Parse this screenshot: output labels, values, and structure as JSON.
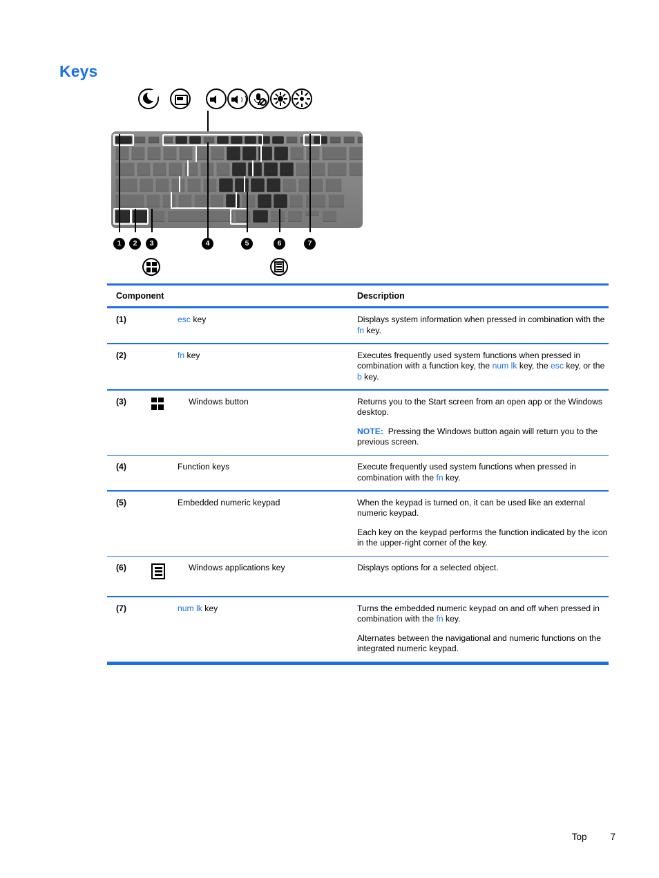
{
  "heading": "Keys",
  "figure": {
    "function_key_icons": [
      {
        "name": "sleep-icon",
        "label": "sleep"
      },
      {
        "name": "display-switch-icon",
        "label": "display switch"
      },
      {
        "name": "volume-down-icon",
        "label": "volume down"
      },
      {
        "name": "volume-up-icon",
        "label": "volume up"
      },
      {
        "name": "microphone-mute-icon",
        "label": "microphone mute"
      },
      {
        "name": "brightness-down-icon",
        "label": "brightness down"
      },
      {
        "name": "brightness-up-icon",
        "label": "brightness up"
      }
    ],
    "callouts": [
      "1",
      "2",
      "3",
      "4",
      "5",
      "6",
      "7"
    ],
    "callout_icons": [
      {
        "name": "windows-key-icon",
        "for_callout": "3"
      },
      {
        "name": "windows-applications-key-icon",
        "for_callout": "6"
      }
    ],
    "keyboard_keys": [
      "esc",
      "fn",
      "Windows",
      "Function keys",
      "Embedded numeric keypad",
      "Windows applications key",
      "num lk"
    ]
  },
  "table": {
    "headers": {
      "component": "Component",
      "description": "Description"
    },
    "rows": [
      {
        "number": "(1)",
        "icon": "",
        "component_pre": "",
        "component_kw": "esc",
        "component_post": " key",
        "description": [
          {
            "segments": [
              {
                "t": "Displays system information when pressed in combination with the ",
                "kw": false
              },
              {
                "t": "fn",
                "kw": true
              },
              {
                "t": " key.",
                "kw": false
              }
            ]
          }
        ]
      },
      {
        "number": "(2)",
        "icon": "",
        "component_pre": "",
        "component_kw": "fn",
        "component_post": " key",
        "description": [
          {
            "segments": [
              {
                "t": "Executes frequently used system functions when pressed in combination with a function key, the ",
                "kw": false
              },
              {
                "t": "num lk",
                "kw": true
              },
              {
                "t": " key, the ",
                "kw": false
              },
              {
                "t": "esc",
                "kw": true
              },
              {
                "t": " key, or the ",
                "kw": false
              },
              {
                "t": "b",
                "kw": true
              },
              {
                "t": " key.",
                "kw": false
              }
            ]
          }
        ]
      },
      {
        "number": "(3)",
        "icon": "windows-logo",
        "component_pre": "Windows button",
        "component_kw": "",
        "component_post": "",
        "description": [
          {
            "segments": [
              {
                "t": "Returns you to the Start screen from an open app or the Windows desktop.",
                "kw": false
              }
            ]
          },
          {
            "note": "NOTE:",
            "segments": [
              {
                "t": "Pressing the Windows button again will return you to the previous screen.",
                "kw": false
              }
            ]
          }
        ]
      },
      {
        "number": "(4)",
        "icon": "",
        "component_pre": "Function keys",
        "component_kw": "",
        "component_post": "",
        "description": [
          {
            "segments": [
              {
                "t": "Execute frequently used system functions when pressed in combination with the ",
                "kw": false
              },
              {
                "t": "fn",
                "kw": true
              },
              {
                "t": " key.",
                "kw": false
              }
            ]
          }
        ]
      },
      {
        "number": "(5)",
        "icon": "",
        "component_pre": "Embedded numeric keypad",
        "component_kw": "",
        "component_post": "",
        "description": [
          {
            "segments": [
              {
                "t": "When the keypad is turned on, it can be used like an external numeric keypad.",
                "kw": false
              }
            ]
          },
          {
            "segments": [
              {
                "t": "Each key on the keypad performs the function indicated by the icon in the upper-right corner of the key.",
                "kw": false
              }
            ]
          }
        ]
      },
      {
        "number": "(6)",
        "icon": "apps-key",
        "component_pre": "Windows applications key",
        "component_kw": "",
        "component_post": "",
        "description": [
          {
            "segments": [
              {
                "t": "Displays options for a selected object.",
                "kw": false
              }
            ]
          }
        ]
      },
      {
        "number": "(7)",
        "icon": "",
        "component_pre": "",
        "component_kw": "num lk",
        "component_post": " key",
        "description": [
          {
            "segments": [
              {
                "t": "Turns the embedded numeric keypad on and off when pressed in combination with the ",
                "kw": false
              },
              {
                "t": "fn",
                "kw": true
              },
              {
                "t": " key.",
                "kw": false
              }
            ]
          },
          {
            "segments": [
              {
                "t": "Alternates between the navigational and numeric functions on the integrated numeric keypad.",
                "kw": false
              }
            ]
          }
        ]
      }
    ]
  },
  "footer": {
    "section": "Top",
    "page_number": "7"
  },
  "colors": {
    "accent_blue": "#1a6fe8",
    "text_black": "#000000"
  }
}
